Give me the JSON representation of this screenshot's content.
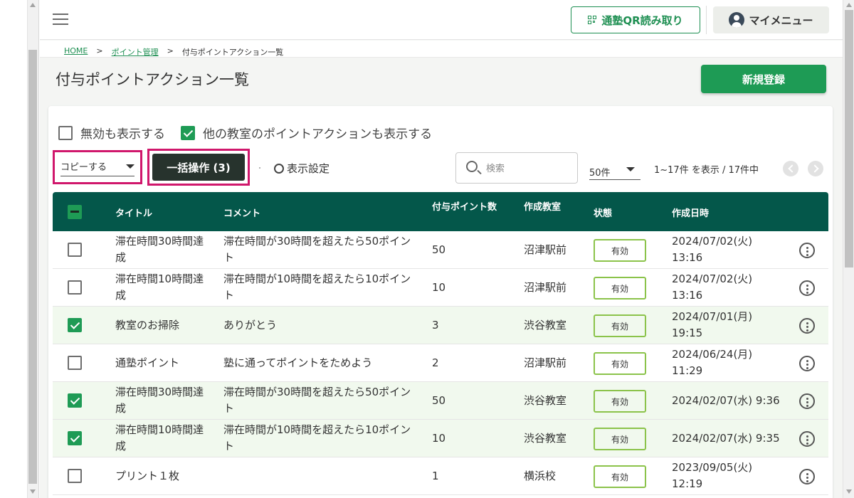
{
  "header": {
    "qr_button": "通塾QR読み取り",
    "my_menu": "マイメニュー"
  },
  "breadcrumb": {
    "home": "HOME",
    "sep": ">",
    "points": "ポイント管理",
    "current": "付与ポイントアクション一覧"
  },
  "page": {
    "title": "付与ポイントアクション一覧",
    "new_button": "新規登録"
  },
  "filters": {
    "show_disabled": {
      "label": "無効も表示する",
      "checked": false
    },
    "show_other_rooms": {
      "label": "他の教室のポイントアクションも表示する",
      "checked": true
    }
  },
  "toolbar": {
    "copy_select": "コピーする",
    "bulk_button": "一括操作 (3)",
    "display_settings": "表示設定",
    "search_placeholder": "検索",
    "per_page": "50件",
    "range": "1~17件 を表示 / 17件中"
  },
  "table": {
    "headers": {
      "title": "タイトル",
      "comment": "コメント",
      "points": "付与ポイント数",
      "room": "作成教室",
      "status": "状態",
      "created": "作成日時"
    },
    "rows": [
      {
        "checked": false,
        "title": "滞在時間30時間達成",
        "comment": "滞在時間が30時間を超えたら50ポイント",
        "points": "50",
        "room": "沼津駅前",
        "status": "有効",
        "created": "2024/07/02(火) 13:16"
      },
      {
        "checked": false,
        "title": "滞在時間10時間達成",
        "comment": "滞在時間が10時間を超えたら10ポイント",
        "points": "10",
        "room": "沼津駅前",
        "status": "有効",
        "created": "2024/07/02(火) 13:16"
      },
      {
        "checked": true,
        "title": "教室のお掃除",
        "comment": "ありがとう",
        "points": "3",
        "room": "渋谷教室",
        "status": "有効",
        "created": "2024/07/01(月) 19:15"
      },
      {
        "checked": false,
        "title": "通塾ポイント",
        "comment": "塾に通ってポイントをためよう",
        "points": "2",
        "room": "沼津駅前",
        "status": "有効",
        "created": "2024/06/24(月) 11:29"
      },
      {
        "checked": true,
        "title": "滞在時間30時間達成",
        "comment": "滞在時間が30時間を超えたら50ポイント",
        "points": "50",
        "room": "渋谷教室",
        "status": "有効",
        "created": "2024/02/07(水) 9:36"
      },
      {
        "checked": true,
        "title": "滞在時間10時間達成",
        "comment": "滞在時間が10時間を超えたら10ポイント",
        "points": "10",
        "room": "渋谷教室",
        "status": "有効",
        "created": "2024/02/07(水) 9:35"
      },
      {
        "checked": false,
        "title": "プリント１枚",
        "comment": "",
        "points": "1",
        "room": "横浜校",
        "status": "有効",
        "created": "2023/09/05(火) 12:19"
      }
    ]
  },
  "colors": {
    "brand_green": "#1e9b55",
    "header_teal": "#04574a",
    "highlight_magenta": "#d0176c",
    "status_border": "#8bc34a",
    "selected_row": "#f1f9ee"
  }
}
